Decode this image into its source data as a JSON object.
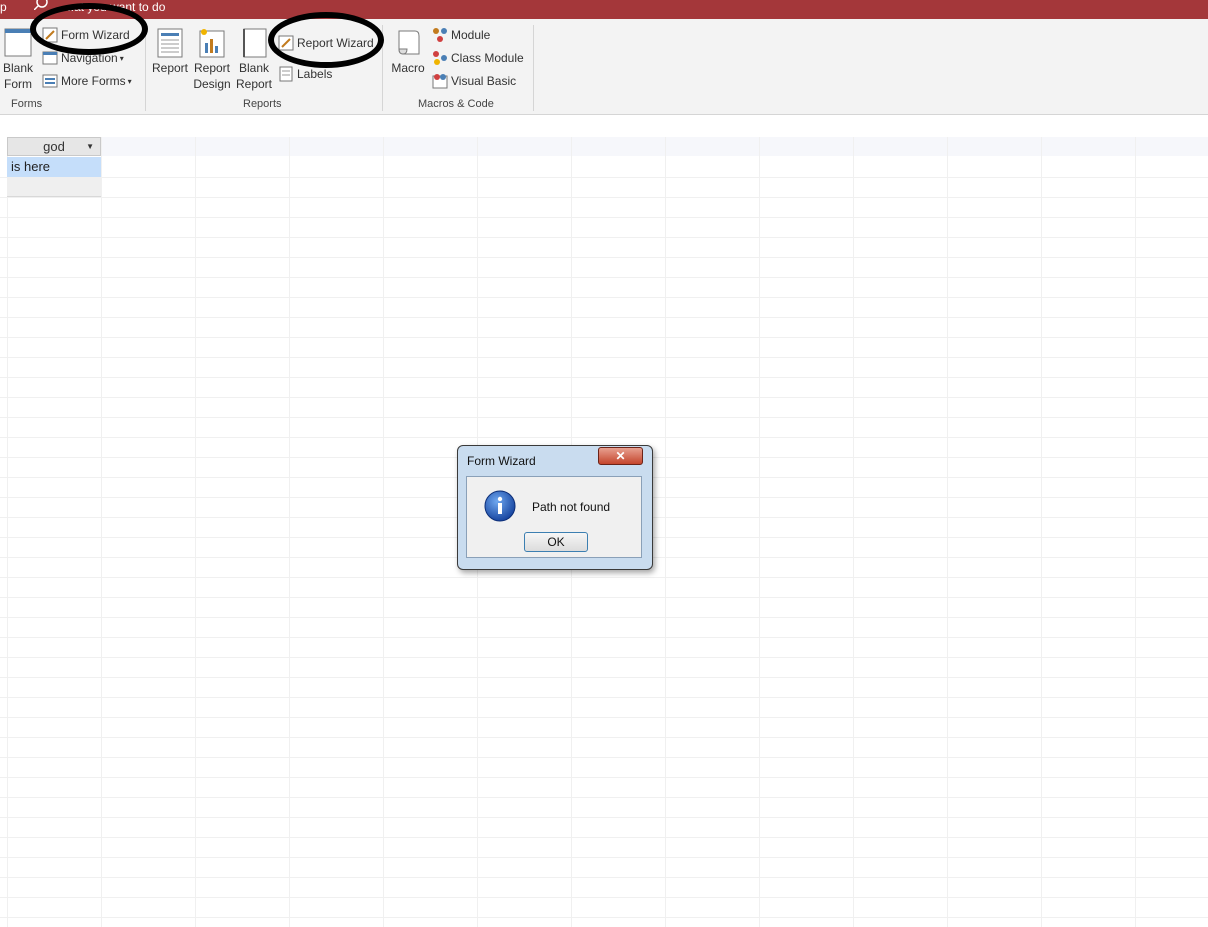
{
  "titlebar": {
    "left_text": "p",
    "tell_me": "...at you want to do"
  },
  "ribbon": {
    "groups": {
      "forms": {
        "label": "Forms",
        "blank_form": [
          "Blank",
          "Form"
        ],
        "form_wizard": "Form Wizard",
        "navigation": "Navigation",
        "more_forms": "More Forms"
      },
      "reports": {
        "label": "Reports",
        "report": "Report",
        "report_design": [
          "Report",
          "Design"
        ],
        "blank_report": [
          "Blank",
          "Report"
        ],
        "report_wizard": "Report Wizard",
        "labels": "Labels"
      },
      "macros": {
        "label": "Macros & Code",
        "macro": "Macro",
        "module": "Module",
        "class_module": "Class Module",
        "visual_basic": "Visual Basic"
      }
    }
  },
  "sheet": {
    "column_header": "god",
    "rows": [
      "is here"
    ]
  },
  "dialog": {
    "title": "Form Wizard",
    "close_glyph": "✕",
    "message": "Path not found",
    "ok_label": "OK",
    "icon": "info-icon"
  },
  "colors": {
    "title_bar": "#a4373a",
    "ribbon_bg": "#f3f3f3",
    "selected_row": "#c5defa",
    "dialog_frame": "#c9dcef",
    "close_button": "#c4452c"
  }
}
